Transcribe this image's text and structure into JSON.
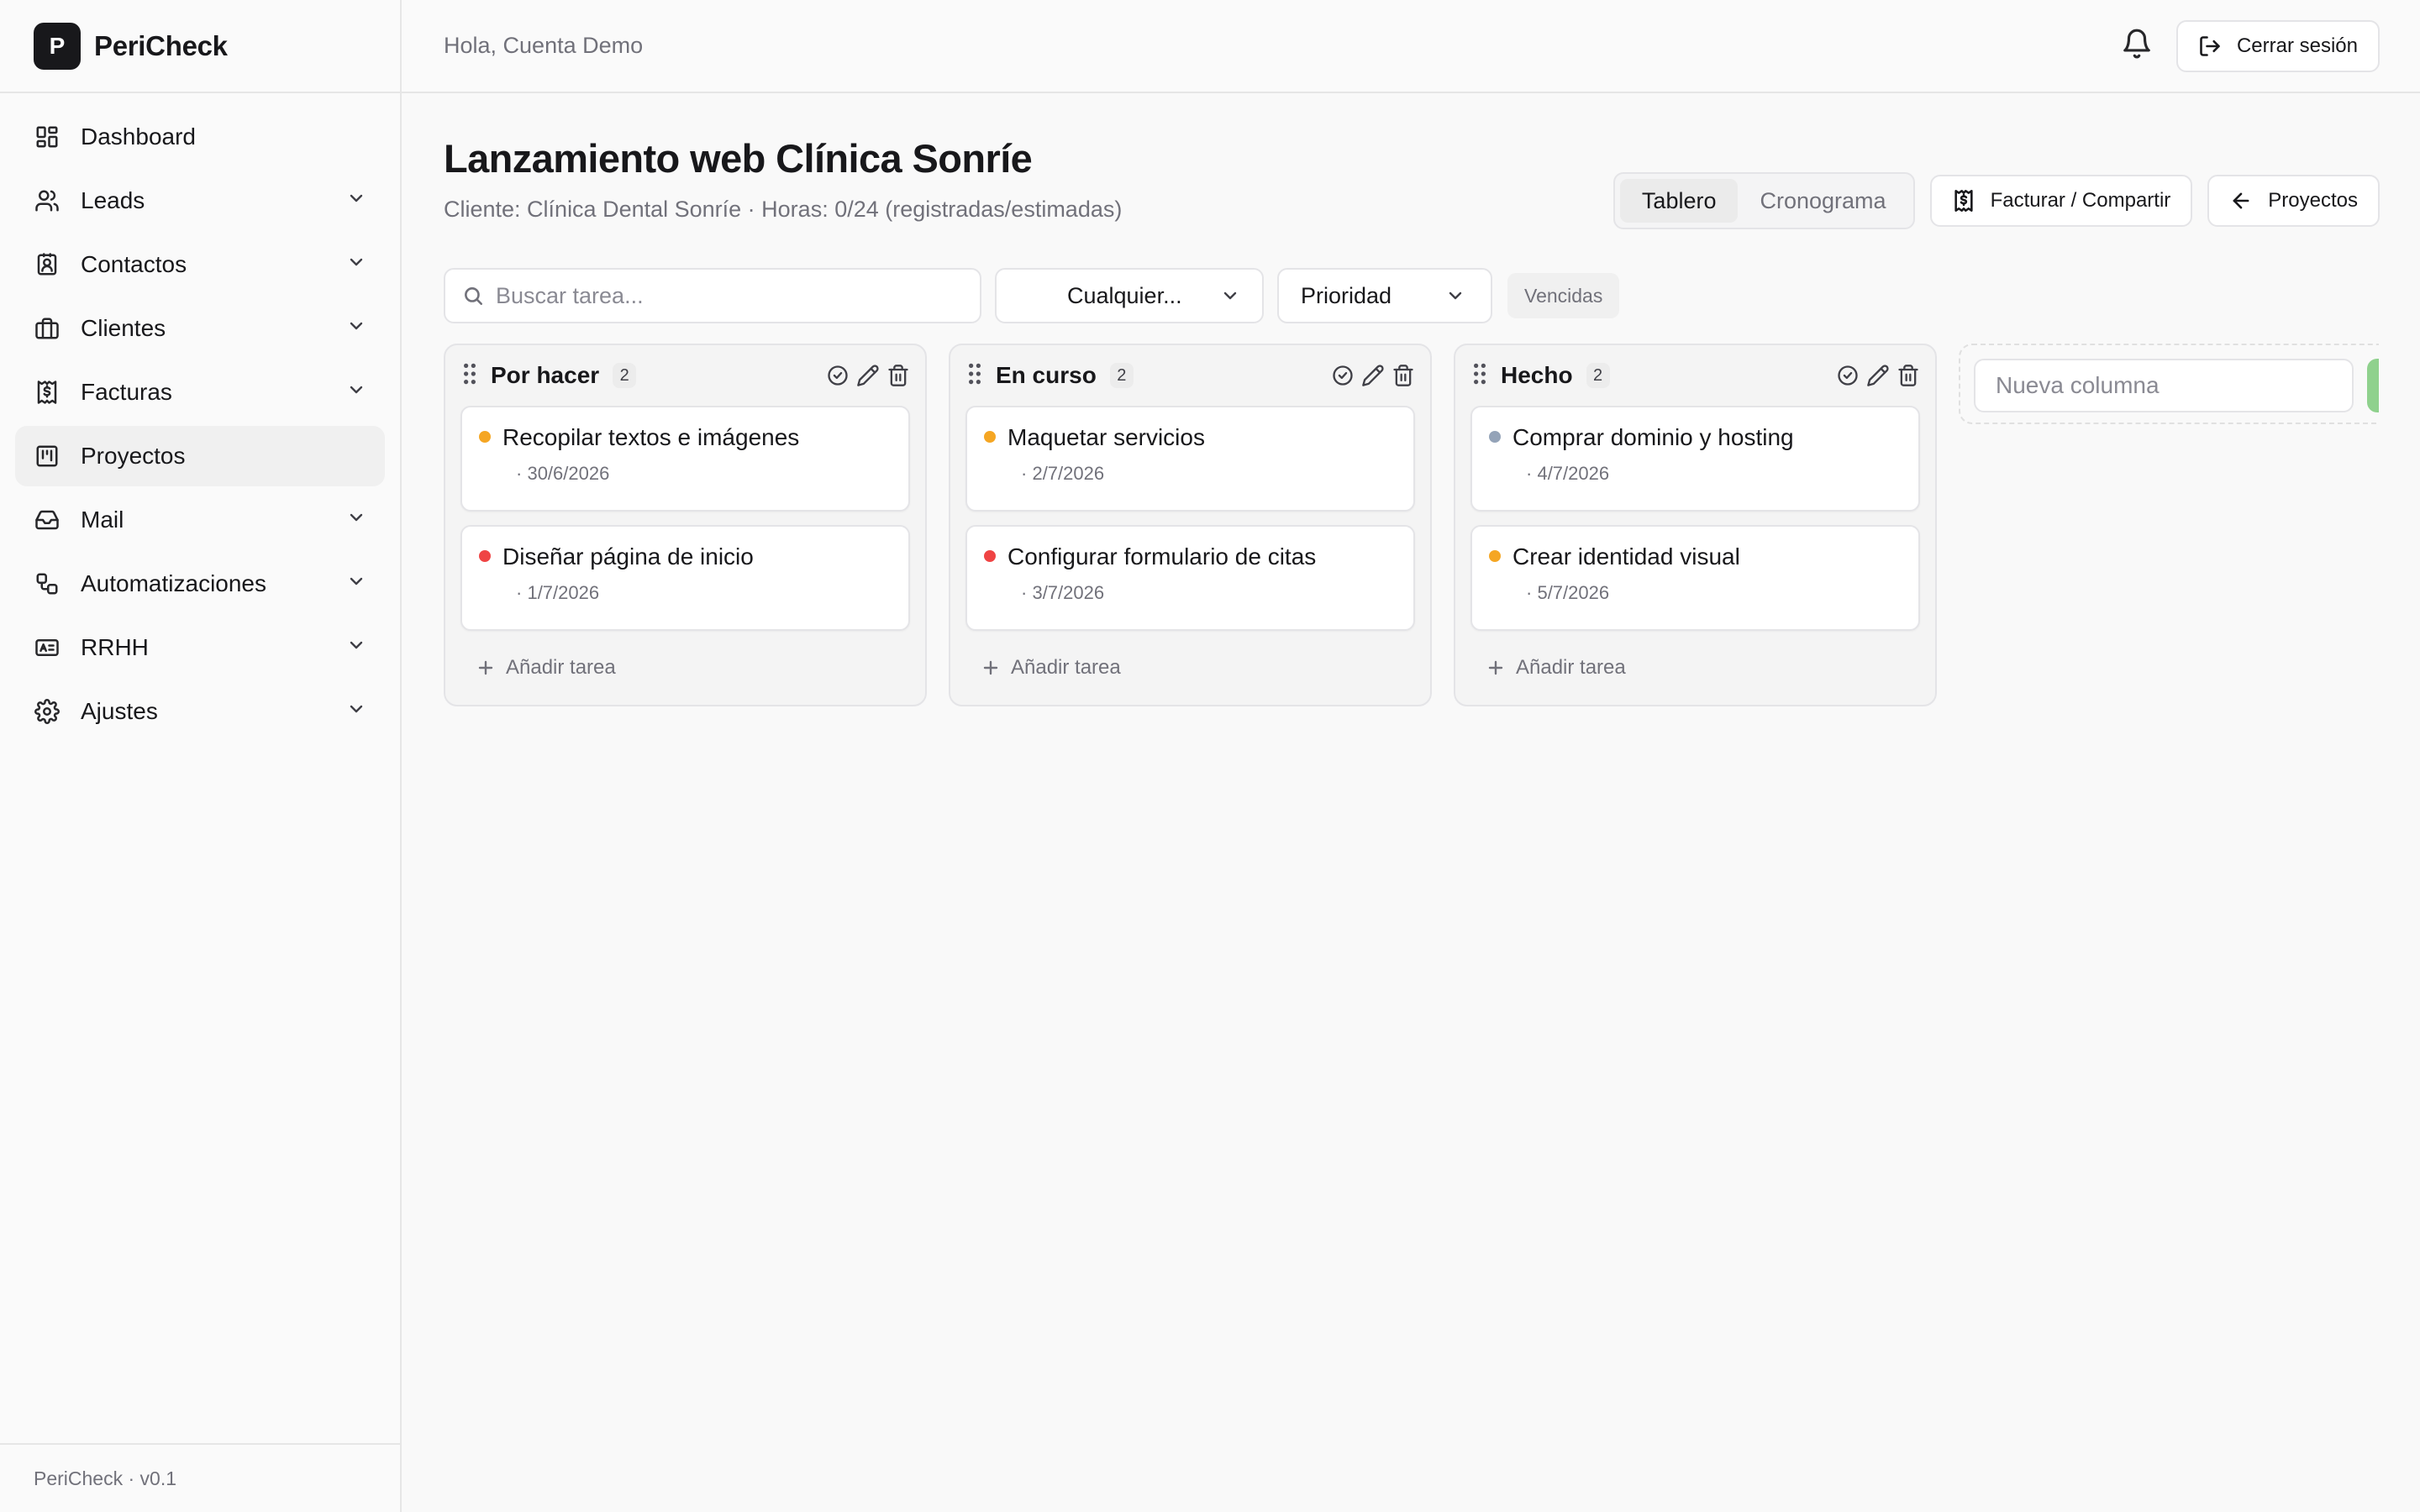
{
  "app": {
    "logo_letter": "P",
    "name": "PeriCheck",
    "version": "PeriCheck · v0.1"
  },
  "topbar": {
    "greeting": "Hola, Cuenta Demo",
    "logout_label": "Cerrar sesión"
  },
  "sidebar": {
    "items": [
      {
        "label": "Dashboard",
        "icon": "dashboard-icon",
        "expandable": false,
        "active": false
      },
      {
        "label": "Leads",
        "icon": "users-icon",
        "expandable": true,
        "active": false
      },
      {
        "label": "Contactos",
        "icon": "contact-card-icon",
        "expandable": true,
        "active": false
      },
      {
        "label": "Clientes",
        "icon": "briefcase-icon",
        "expandable": true,
        "active": false
      },
      {
        "label": "Facturas",
        "icon": "invoice-icon",
        "expandable": true,
        "active": false
      },
      {
        "label": "Proyectos",
        "icon": "kanban-icon",
        "expandable": false,
        "active": true
      },
      {
        "label": "Mail",
        "icon": "inbox-icon",
        "expandable": true,
        "active": false
      },
      {
        "label": "Automatizaciones",
        "icon": "workflow-icon",
        "expandable": true,
        "active": false
      },
      {
        "label": "RRHH",
        "icon": "id-card-icon",
        "expandable": true,
        "active": false
      },
      {
        "label": "Ajustes",
        "icon": "gear-icon",
        "expandable": true,
        "active": false
      }
    ]
  },
  "project": {
    "title": "Lanzamiento web Clínica Sonríe",
    "subtitle": "Cliente: Clínica Dental Sonríe · Horas: 0/24 (registradas/estimadas)"
  },
  "view_toggle": {
    "options": [
      "Tablero",
      "Cronograma"
    ],
    "selected": "Tablero"
  },
  "actions": {
    "invoice_share": "Facturar / Compartir",
    "back_projects": "Proyectos"
  },
  "filters": {
    "search_placeholder": "Buscar tarea...",
    "assignee_value": "Cualquier...",
    "priority_value": "Prioridad",
    "overdue_label": "Vencidas"
  },
  "colors": {
    "high": "#ef4444",
    "medium": "#f5a623",
    "low": "#94a3b8",
    "accent_green": "#8fd18d"
  },
  "columns": [
    {
      "title": "Por hacer",
      "count": "2",
      "add_label": "Añadir tarea",
      "tasks": [
        {
          "title": "Recopilar textos e imágenes",
          "date": "30/6/2026",
          "priority": "medium"
        },
        {
          "title": "Diseñar página de inicio",
          "date": "1/7/2026",
          "priority": "high"
        }
      ]
    },
    {
      "title": "En curso",
      "count": "2",
      "add_label": "Añadir tarea",
      "tasks": [
        {
          "title": "Maquetar servicios",
          "date": "2/7/2026",
          "priority": "medium"
        },
        {
          "title": "Configurar formulario de citas",
          "date": "3/7/2026",
          "priority": "high"
        }
      ]
    },
    {
      "title": "Hecho",
      "count": "2",
      "add_label": "Añadir tarea",
      "tasks": [
        {
          "title": "Comprar dominio y hosting",
          "date": "4/7/2026",
          "priority": "low"
        },
        {
          "title": "Crear identidad visual",
          "date": "5/7/2026",
          "priority": "medium"
        }
      ]
    }
  ],
  "new_column": {
    "placeholder": "Nueva columna"
  }
}
